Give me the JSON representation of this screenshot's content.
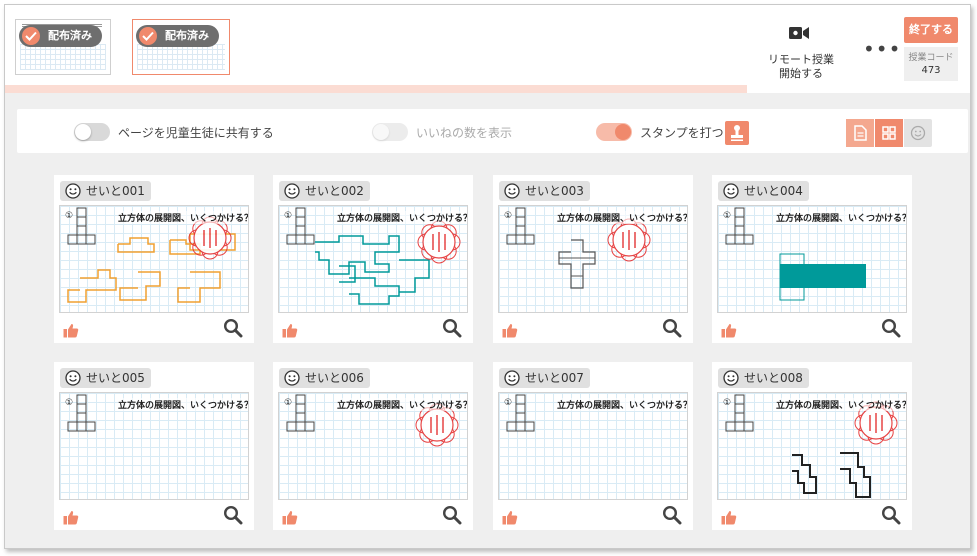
{
  "thumbnails": [
    {
      "badge": "配布済み",
      "selected": false
    },
    {
      "badge": "配布済み",
      "selected": true
    }
  ],
  "remote": {
    "label_line1": "リモート授業",
    "label_line2": "開始する",
    "icon": "video-camera-icon"
  },
  "more_icon": "more-dots-icon",
  "end_button": "終了する",
  "class_code": {
    "label": "授業コード",
    "value": "473"
  },
  "toolbar": {
    "share_label": "ページを児童生徒に共有する",
    "likes_label": "いいねの数を表示",
    "stamp_label": "スタンプを打つ",
    "share_on": false,
    "likes_on": false,
    "stamp_on": true
  },
  "colors": {
    "accent": "#f0896c",
    "accent_light": "#f7bba9",
    "teal": "#009a9a",
    "orange": "#f0a030",
    "stamp_red": "#e53030"
  },
  "question_text": "立方体の展開図、いくつかける？",
  "question_marker": "①",
  "cards": [
    {
      "name": "せいと001",
      "stamp": true,
      "drawing": "orange-nets"
    },
    {
      "name": "せいと002",
      "stamp": true,
      "drawing": "teal-nets"
    },
    {
      "name": "せいと003",
      "stamp": true,
      "drawing": "cross-net"
    },
    {
      "name": "せいと004",
      "stamp": false,
      "drawing": "teal-bar"
    },
    {
      "name": "せいと005",
      "stamp": false,
      "drawing": "none"
    },
    {
      "name": "せいと006",
      "stamp": true,
      "drawing": "none"
    },
    {
      "name": "せいと007",
      "stamp": false,
      "drawing": "none"
    },
    {
      "name": "せいと008",
      "stamp": true,
      "drawing": "black-nets"
    }
  ]
}
